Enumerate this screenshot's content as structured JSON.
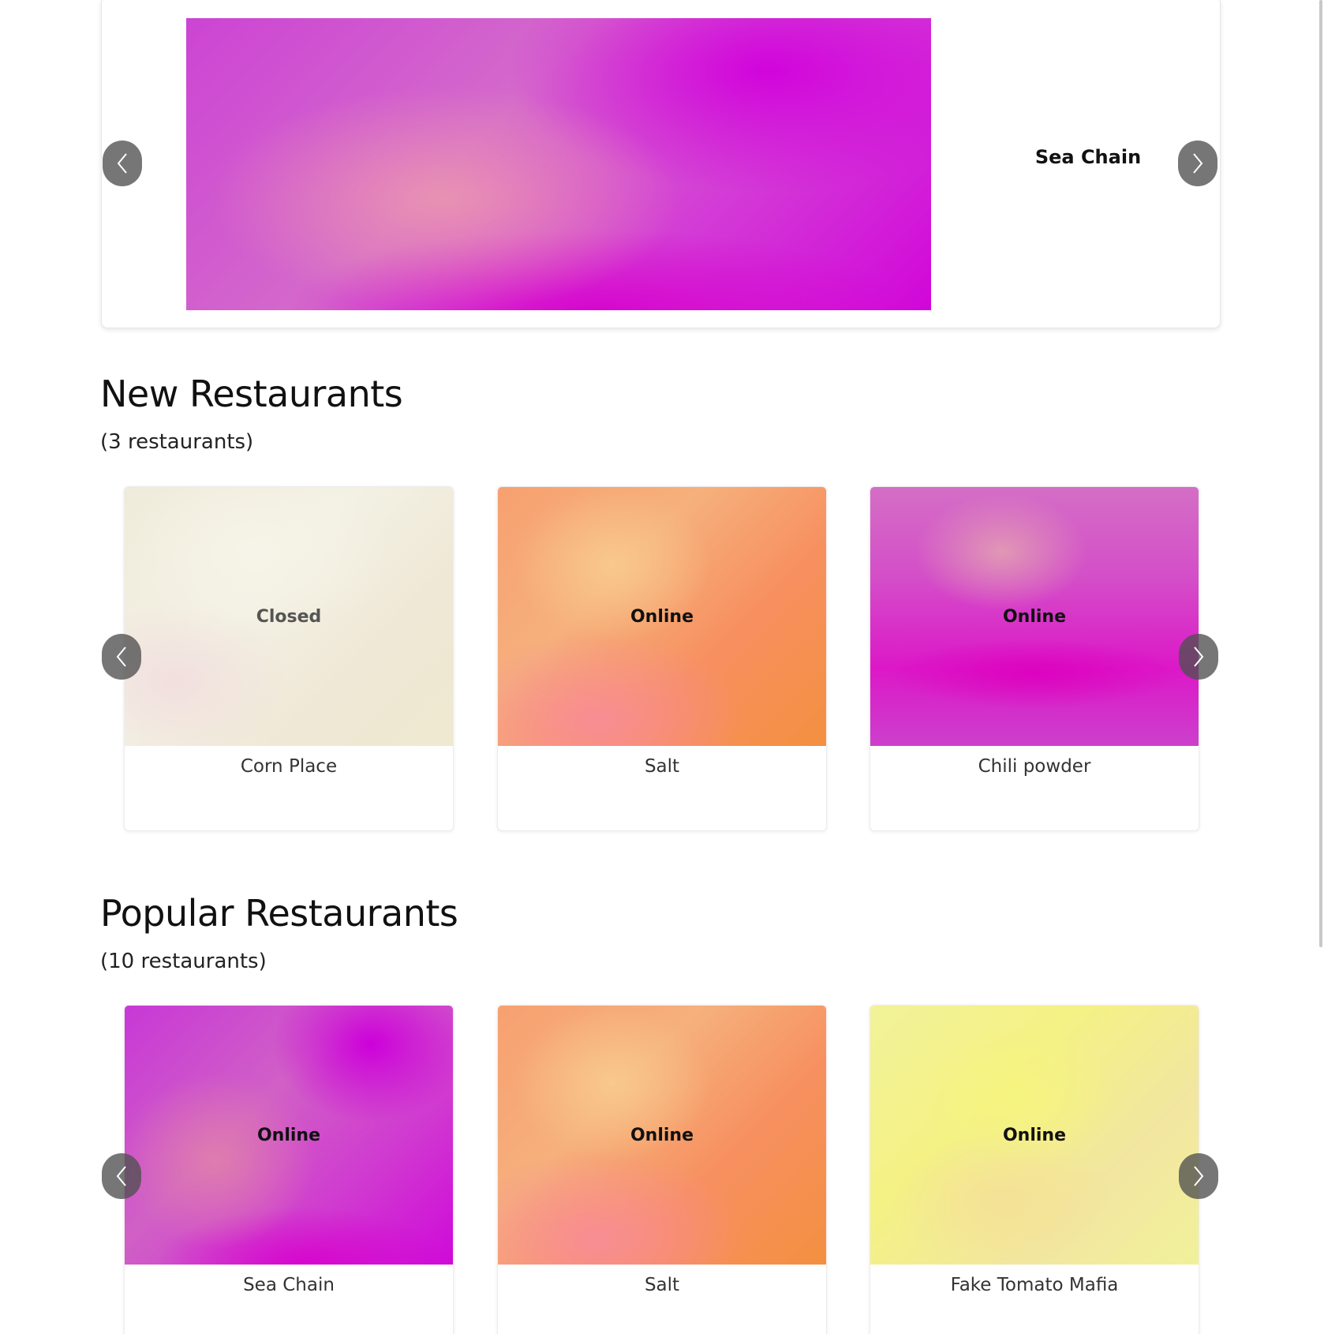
{
  "hero": {
    "title": "Sea Chain",
    "gradient": "magenta"
  },
  "sections": {
    "new": {
      "title": "New Restaurants",
      "count": "(3 restaurants)",
      "cards": [
        {
          "status": "Closed",
          "name": "Corn Place",
          "gradient": "cream"
        },
        {
          "status": "Online",
          "name": "Salt",
          "gradient": "orange"
        },
        {
          "status": "Online",
          "name": "Chili powder",
          "gradient": "magenta-light"
        }
      ]
    },
    "popular": {
      "title": "Popular Restaurants",
      "count": "(10 restaurants)",
      "cards": [
        {
          "status": "Online",
          "name": "Sea Chain",
          "gradient": "magenta"
        },
        {
          "status": "Online",
          "name": "Salt",
          "gradient": "orange"
        },
        {
          "status": "Online",
          "name": "Fake Tomato Mafia",
          "gradient": "yellow"
        }
      ]
    }
  },
  "icons": {
    "prev": "chevron-left-icon",
    "next": "chevron-right-icon"
  },
  "colors": {
    "nav_button_bg": "#505050",
    "card_border": "#ececec",
    "magenta": "#d106d9",
    "orange": "#f39040",
    "yellow": "#f4f284",
    "cream": "#f0ebda"
  }
}
